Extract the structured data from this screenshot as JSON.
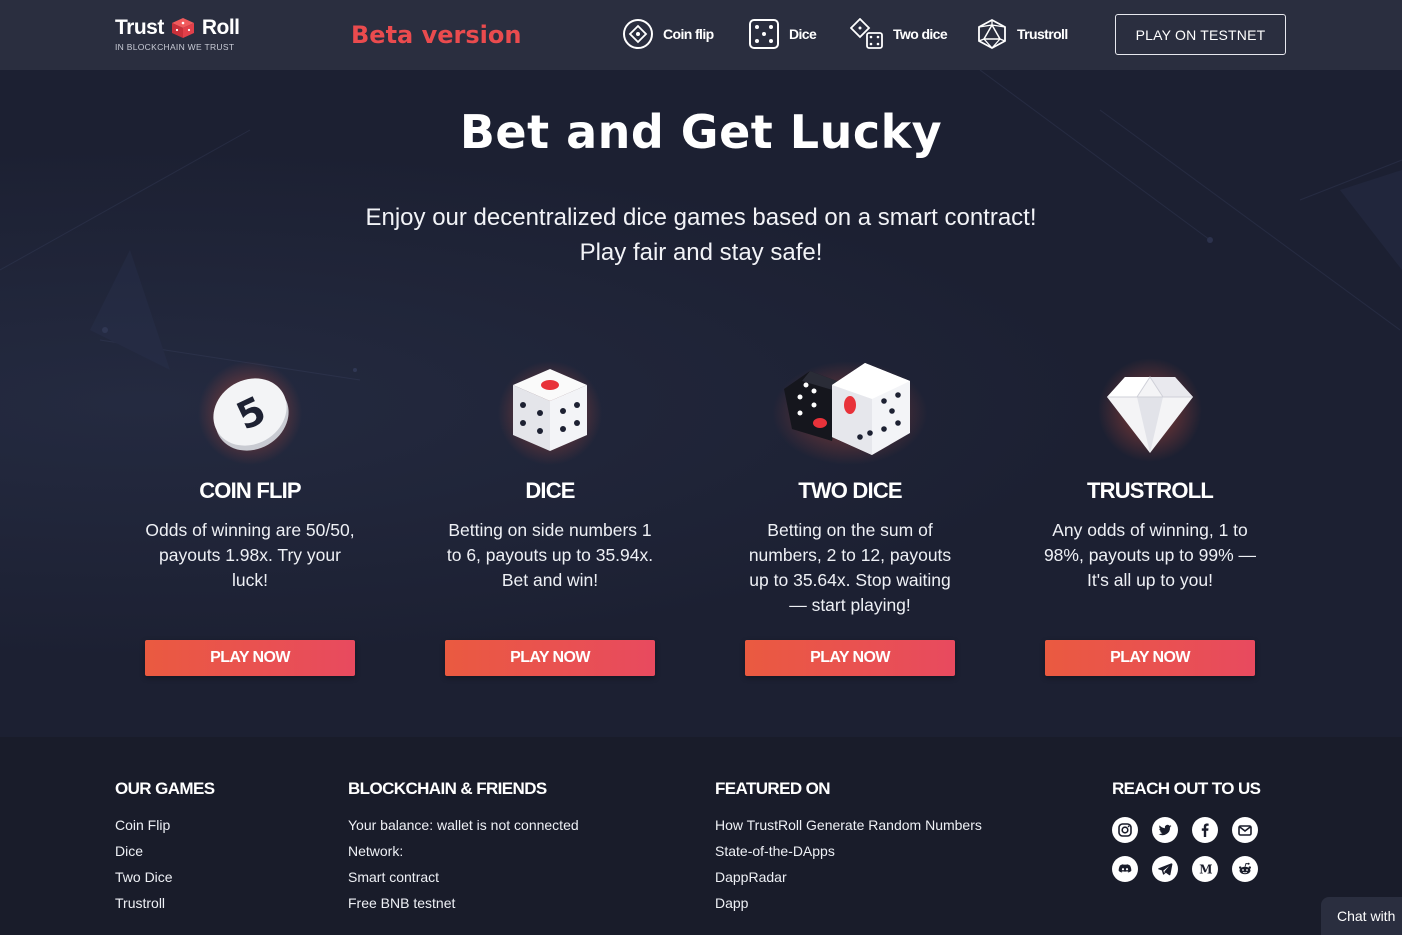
{
  "header": {
    "logo_left": "Trust",
    "logo_right": "Roll",
    "logo_tagline": "IN BLOCKCHAIN WE TRUST",
    "beta_label": "Beta version",
    "nav": [
      {
        "label": "Coin flip",
        "icon": "coin-icon"
      },
      {
        "label": "Dice",
        "icon": "dice-icon"
      },
      {
        "label": "Two dice",
        "icon": "two-dice-icon"
      },
      {
        "label": "Trustroll",
        "icon": "trustroll-icon"
      }
    ],
    "testnet_button": "PLAY ON TESTNET"
  },
  "hero": {
    "title": "Bet and Get Lucky",
    "subtitle_line1": "Enjoy our decentralized dice games based on a smart contract!",
    "subtitle_line2": "Play fair and stay safe!"
  },
  "games": [
    {
      "title": "COIN FLIP",
      "description": "Odds of winning are 50/50, payouts 1.98x. Try your luck!",
      "button": "PLAY NOW",
      "icon": "coin-five-icon"
    },
    {
      "title": "DICE",
      "description": "Betting on side numbers 1 to 6, payouts up to 35.94x. Bet and win!",
      "button": "PLAY NOW",
      "icon": "white-die-icon"
    },
    {
      "title": "TWO DICE",
      "description": "Betting on the sum of numbers, 2 to 12, payouts up to 35.64x. Stop waiting — start playing!",
      "button": "PLAY NOW",
      "icon": "two-dice-icon"
    },
    {
      "title": "TRUSTROLL",
      "description": "Any odds of winning, 1 to 98%, payouts up to 99% — It's all up to you!",
      "button": "PLAY NOW",
      "icon": "diamond-icon"
    }
  ],
  "footer": {
    "our_games": {
      "heading": "OUR GAMES",
      "links": [
        "Coin Flip",
        "Dice",
        "Two Dice",
        "Trustroll"
      ]
    },
    "blockchain": {
      "heading": "BLOCKCHAIN & FRIENDS",
      "links": [
        "Your balance: wallet is not connected",
        "Network:",
        "Smart contract",
        "Free BNB testnet"
      ]
    },
    "featured": {
      "heading": "FEATURED ON",
      "links": [
        "How TrustRoll Generate Random Numbers",
        "State-of-the-DApps",
        "DappRadar",
        "Dapp"
      ]
    },
    "reach_out": {
      "heading": "REACH OUT TO US",
      "icons": [
        "instagram-icon",
        "twitter-icon",
        "facebook-icon",
        "email-icon",
        "discord-icon",
        "telegram-icon",
        "medium-icon",
        "reddit-icon"
      ]
    }
  },
  "chat_label": "Chat with",
  "colors": {
    "accent": "#ea4b4e",
    "header_bg": "#2a2e3f",
    "page_bg": "#1d2132",
    "footer_bg": "#191c2a",
    "button_start": "#ea5a40",
    "button_end": "#e84a5f"
  }
}
